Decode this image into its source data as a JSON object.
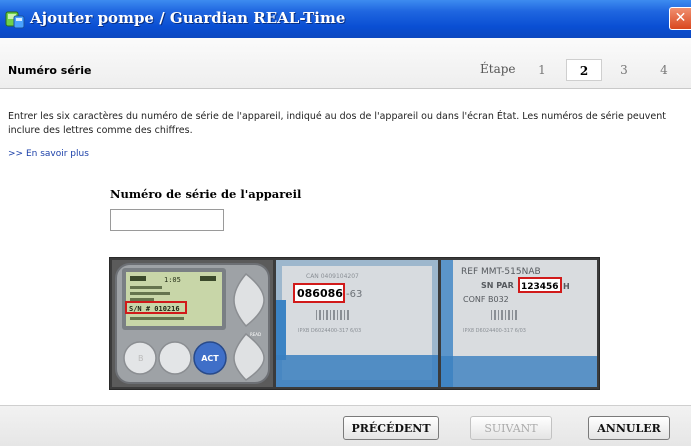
{
  "window": {
    "title": "Ajouter pompe / Guardian REAL-Time",
    "close_glyph": "✕"
  },
  "step_bar": {
    "title": "Numéro série",
    "step_label": "Étape",
    "steps": [
      "1",
      "2",
      "3",
      "4"
    ],
    "active_step": "2"
  },
  "content": {
    "description": "Entrer les six caractères du numéro de série de l'appareil, indiqué au dos de l'appareil ou dans l'écran État. Les numéros de série peuvent inclure des lettres comme des chiffres.",
    "learn_more": ">> En savoir plus",
    "serial_label": "Numéro de série de l'appareil",
    "serial_value": ""
  },
  "device_images": {
    "pump_screen": {
      "time": "1:05",
      "serial_text": "S/N # 010216",
      "act_button": "ACT"
    },
    "back_label_1": {
      "header": "CAN 0409104207",
      "serial": "086086",
      "suffix": "-63",
      "footer": "IPXB D6024400-317 6/03"
    },
    "back_label_2": {
      "ref": "REF MMT-515NAB",
      "sn_prefix": "SN PAR",
      "serial": "123456",
      "suffix": "H",
      "conf": "CONF B032",
      "footer": "IPX8 D6024400-317 6/03"
    }
  },
  "footer": {
    "previous": "PRÉCÉDENT",
    "next": "SUIVANT",
    "cancel": "ANNULER"
  },
  "colors": {
    "titlebar": "#0a4fd3",
    "close": "#d9471e",
    "highlight_box": "#d11a1a",
    "link": "#1a3fa8"
  }
}
